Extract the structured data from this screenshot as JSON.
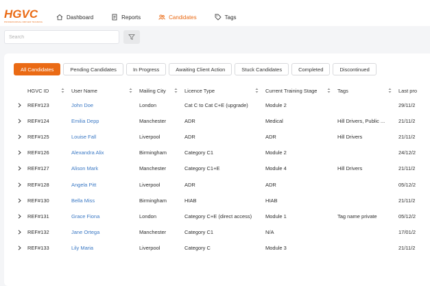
{
  "app": {
    "logo_text": "HGVC",
    "logo_tagline": "PROFESSIONAL DRIVER TRAINING"
  },
  "nav": [
    {
      "label": "Dashboard",
      "icon": "home-icon",
      "active": false
    },
    {
      "label": "Reports",
      "icon": "document-icon",
      "active": false
    },
    {
      "label": "Candidates",
      "icon": "users-icon",
      "active": true
    },
    {
      "label": "Tags",
      "icon": "tag-icon",
      "active": false
    }
  ],
  "search": {
    "placeholder": "Search"
  },
  "colors": {
    "accent": "#ea6a14",
    "link": "#3a78c4"
  },
  "tabs": [
    {
      "label": "All Candidates",
      "active": true
    },
    {
      "label": "Pending Candidates",
      "active": false
    },
    {
      "label": "In Progress",
      "active": false
    },
    {
      "label": "Awaiting Client Action",
      "active": false
    },
    {
      "label": "Stuck Candidates",
      "active": false
    },
    {
      "label": "Completed",
      "active": false
    },
    {
      "label": "Discontinued",
      "active": false
    }
  ],
  "table": {
    "columns": [
      "HGVC ID",
      "User Name",
      "Mailing City",
      "Licence Type",
      "Current Training Stage",
      "Tags",
      "Last pro"
    ],
    "rows": [
      {
        "id": "REF#123",
        "name": "John Doe",
        "city": "London",
        "licence": "Cat C to Cat C+E (upgrade)",
        "stage": "Module 2",
        "tags": "",
        "last": "29/11/2"
      },
      {
        "id": "REF#124",
        "name": "Emilia Depp",
        "city": "Manchester",
        "licence": "ADR",
        "stage": "Medical",
        "tags": "Hill Drivers, Public ...",
        "last": "21/11/2"
      },
      {
        "id": "REF#125",
        "name": "Louise Fall",
        "city": "Liverpool",
        "licence": "ADR",
        "stage": "ADR",
        "tags": "Hill Drivers",
        "last": "21/11/2"
      },
      {
        "id": "REF#126",
        "name": "Alexandra Alix",
        "city": "Birmingham",
        "licence": "Category C1",
        "stage": "Module 2",
        "tags": "",
        "last": "24/12/2"
      },
      {
        "id": "REF#127",
        "name": "Alison Mark",
        "city": "Manchester",
        "licence": "Category C1+E",
        "stage": "Module 4",
        "tags": "Hill Drivers",
        "last": "21/11/2"
      },
      {
        "id": "REF#128",
        "name": "Angela Pitt",
        "city": "Liverpool",
        "licence": "ADR",
        "stage": "ADR",
        "tags": "",
        "last": "05/12/2"
      },
      {
        "id": "REF#130",
        "name": "Bella Miss",
        "city": "Birmingham",
        "licence": "HIAB",
        "stage": "HIAB",
        "tags": "",
        "last": "21/11/2"
      },
      {
        "id": "REF#131",
        "name": "Grace Fiona",
        "city": "London",
        "licence": "Category C+E (direct access)",
        "stage": "Module 1",
        "tags": "Tag name private",
        "last": "05/12/2"
      },
      {
        "id": "REF#132",
        "name": "Jane Ortega",
        "city": "Manchester",
        "licence": "Category C1",
        "stage": "N/A",
        "tags": "",
        "last": "17/01/2"
      },
      {
        "id": "REF#133",
        "name": "Lily Maria",
        "city": "Liverpool",
        "licence": "Category C",
        "stage": "Module 3",
        "tags": "",
        "last": "21/11/2"
      }
    ]
  }
}
